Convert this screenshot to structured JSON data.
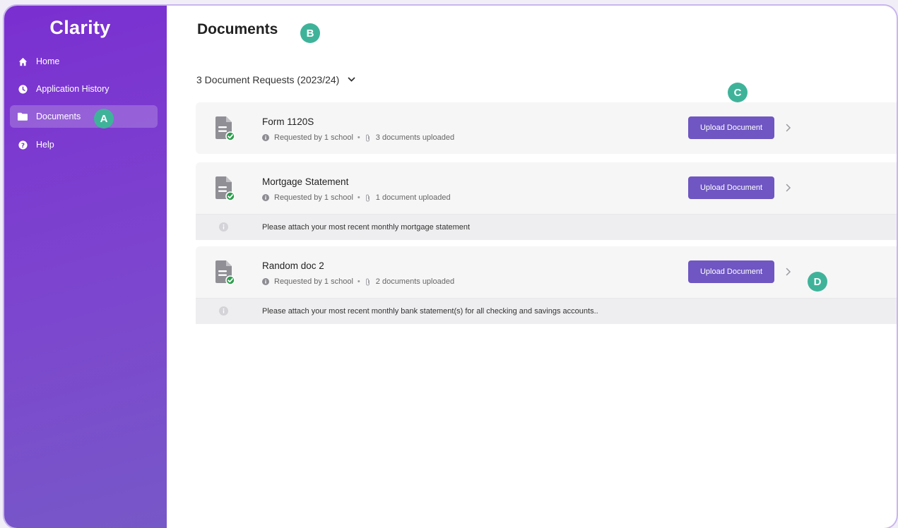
{
  "app": {
    "brand": "Clarity"
  },
  "sidebar": {
    "items": [
      {
        "label": "Home",
        "icon": "home-icon"
      },
      {
        "label": "Application History",
        "icon": "clock-icon"
      },
      {
        "label": "Documents",
        "icon": "folder-icon",
        "active": true
      },
      {
        "label": "Help",
        "icon": "question-circle-icon"
      }
    ]
  },
  "markers": {
    "a": "A",
    "b": "B",
    "c": "C",
    "d": "D"
  },
  "main": {
    "title": "Documents",
    "summary": "3 Document Requests (2023/24)",
    "documents": [
      {
        "title": "Form 1120S",
        "requested": "Requested by 1 school",
        "uploaded": "3 documents uploaded",
        "button": "Upload Document",
        "note": ""
      },
      {
        "title": "Mortgage Statement",
        "requested": "Requested by 1 school",
        "uploaded": "1 document uploaded",
        "button": "Upload Document",
        "note": "Please attach your most recent monthly mortgage statement"
      },
      {
        "title": "Random doc 2",
        "requested": "Requested by 1 school",
        "uploaded": "2 documents uploaded",
        "button": "Upload Document",
        "note": "Please attach your most recent monthly bank statement(s) for all checking and savings accounts.."
      }
    ]
  },
  "colors": {
    "sidebar_top": "#7a2fd0",
    "sidebar_bottom": "#7758c8",
    "button": "#6f56c2",
    "marker": "#3fb39a",
    "check": "#2e9e4f",
    "card": "#f6f6f7"
  }
}
